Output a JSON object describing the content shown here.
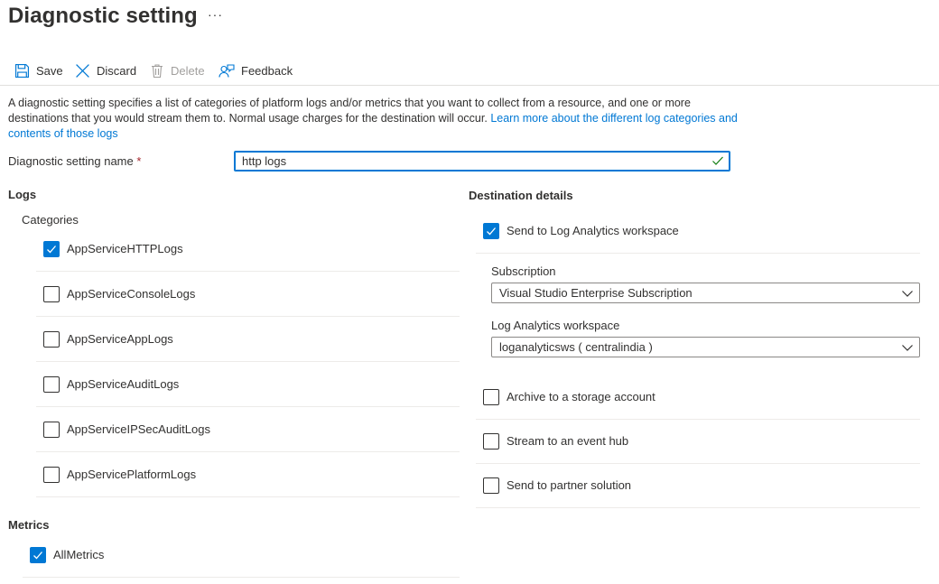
{
  "page": {
    "title": "Diagnostic setting",
    "more": "···"
  },
  "toolbar": {
    "save": "Save",
    "discard": "Discard",
    "delete": "Delete",
    "feedback": "Feedback"
  },
  "description": {
    "text": "A diagnostic setting specifies a list of categories of platform logs and/or metrics that you want to collect from a resource, and one or more destinations that you would stream them to. Normal usage charges for the destination will occur. ",
    "link": "Learn more about the different log categories and contents of those logs"
  },
  "name_field": {
    "label": "Diagnostic setting name",
    "required_mark": "*",
    "value": "http logs"
  },
  "logs": {
    "heading": "Logs",
    "categories_heading": "Categories",
    "items": [
      {
        "label": "AppServiceHTTPLogs",
        "checked": true
      },
      {
        "label": "AppServiceConsoleLogs",
        "checked": false
      },
      {
        "label": "AppServiceAppLogs",
        "checked": false
      },
      {
        "label": "AppServiceAuditLogs",
        "checked": false
      },
      {
        "label": "AppServiceIPSecAuditLogs",
        "checked": false
      },
      {
        "label": "AppServicePlatformLogs",
        "checked": false
      }
    ]
  },
  "metrics": {
    "heading": "Metrics",
    "items": [
      {
        "label": "AllMetrics",
        "checked": true
      }
    ]
  },
  "destination": {
    "heading": "Destination details",
    "log_analytics": {
      "label": "Send to Log Analytics workspace",
      "checked": true
    },
    "subscription": {
      "label": "Subscription",
      "value": "Visual Studio Enterprise Subscription"
    },
    "workspace": {
      "label": "Log Analytics workspace",
      "value": "loganalyticsws ( centralindia )"
    },
    "storage": {
      "label": "Archive to a storage account",
      "checked": false
    },
    "event_hub": {
      "label": "Stream to an event hub",
      "checked": false
    },
    "partner": {
      "label": "Send to partner solution",
      "checked": false
    }
  },
  "colors": {
    "accent": "#0078d4",
    "text": "#323130",
    "disabled": "#a19f9d",
    "success": "#107c10",
    "required": "#a4262c"
  }
}
